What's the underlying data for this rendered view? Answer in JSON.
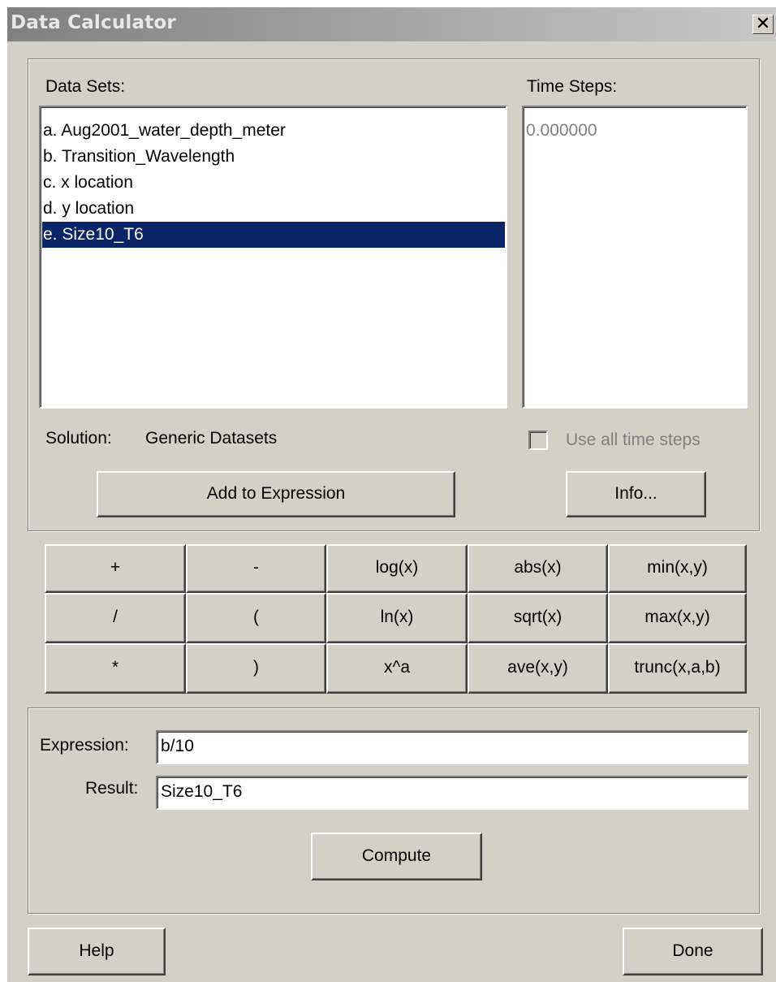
{
  "window": {
    "title": "Data Calculator",
    "close_glyph": "✕",
    "close_icon": "close-icon"
  },
  "datasets": {
    "label": "Data Sets:",
    "items": [
      "a. Aug2001_water_depth_meter",
      "b. Transition_Wavelength",
      "c. x location",
      "d. y location",
      "e. Size10_T6"
    ],
    "selected": "e. Size10_T6"
  },
  "timesteps": {
    "label": "Time Steps:",
    "items": [
      "0.000000"
    ]
  },
  "solution": {
    "label": "Solution:",
    "value": "Generic Datasets"
  },
  "use_all_time_steps": {
    "label": "Use all time steps",
    "checked": false,
    "enabled": false
  },
  "buttons": {
    "add_to_expression": "Add to Expression",
    "info": "Info...",
    "compute": "Compute",
    "help": "Help",
    "done": "Done"
  },
  "operators": [
    [
      "+",
      "-",
      "log(x)",
      "abs(x)",
      "min(x,y)"
    ],
    [
      "/",
      "(",
      "ln(x)",
      "sqrt(x)",
      "max(x,y)"
    ],
    [
      "*",
      ")",
      "x^a",
      "ave(x,y)",
      "trunc(x,a,b)"
    ]
  ],
  "expression": {
    "label": "Expression:",
    "value": "b/10"
  },
  "result": {
    "label": "Result:",
    "value": "Size10_T6"
  }
}
